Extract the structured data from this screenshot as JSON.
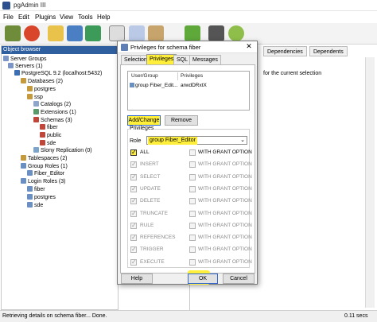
{
  "app": {
    "title": "pgAdmin III"
  },
  "menu": [
    "File",
    "Edit",
    "Plugins",
    "View",
    "Tools",
    "Help"
  ],
  "toolbar_icons": [
    "connect-icon",
    "refresh-icon",
    "folder-icon",
    "properties-icon",
    "recycle-icon",
    "sql-icon",
    "table-icon",
    "pencil-icon",
    "plugin-icon",
    "filter-icon",
    "help-icon"
  ],
  "object_browser": {
    "header": "Object browser",
    "tree": [
      {
        "label": "Server Groups",
        "icon": "server-groups-icon"
      },
      {
        "label": "Servers (1)",
        "icon": "servers-icon"
      },
      {
        "label": "PostgreSQL 9.2 (localhost:5432)",
        "icon": "server-icon"
      },
      {
        "label": "Databases (2)",
        "icon": "databases-icon"
      },
      {
        "label": "postgres",
        "icon": "database-icon"
      },
      {
        "label": "ssp",
        "icon": "database-icon"
      },
      {
        "label": "Catalogs (2)",
        "icon": "catalogs-icon"
      },
      {
        "label": "Extensions (1)",
        "icon": "extensions-icon"
      },
      {
        "label": "Schemas (3)",
        "icon": "schemas-icon"
      },
      {
        "label": "fiber",
        "icon": "schema-icon"
      },
      {
        "label": "public",
        "icon": "schema-icon"
      },
      {
        "label": "sde",
        "icon": "schema-icon"
      },
      {
        "label": "Slony Replication (0)",
        "icon": "slony-icon"
      },
      {
        "label": "Tablespaces (2)",
        "icon": "tablespaces-icon"
      },
      {
        "label": "Group Roles (1)",
        "icon": "group-roles-icon"
      },
      {
        "label": "Fiber_Editor",
        "icon": "group-role-icon"
      },
      {
        "label": "Login Roles (3)",
        "icon": "login-roles-icon"
      },
      {
        "label": "fiber",
        "icon": "login-role-icon"
      },
      {
        "label": "postgres",
        "icon": "login-role-icon"
      },
      {
        "label": "sde",
        "icon": "login-role-icon"
      }
    ]
  },
  "right_pane": {
    "tabs": [
      "Dependencies",
      "Dependents"
    ],
    "text": "for the current selection"
  },
  "dialog": {
    "title": "Privileges for schema fiber",
    "tabs": [
      "Selection",
      "Privileges",
      "SQL",
      "Messages"
    ],
    "active_tab": "Privileges",
    "list_headers": [
      "User/Group",
      "Privileges"
    ],
    "list_rows": [
      {
        "user": "group Fiber_Edit...",
        "privileges": "arwdDRxtX"
      }
    ],
    "add_change_label": "Add/Change",
    "remove_label": "Remove",
    "group_label": "Privileges",
    "role_label": "Role",
    "role_value": "group Fiber_Editor",
    "privileges": [
      {
        "name": "ALL",
        "checked": true
      },
      {
        "name": "INSERT",
        "checked": true
      },
      {
        "name": "SELECT",
        "checked": true
      },
      {
        "name": "UPDATE",
        "checked": true
      },
      {
        "name": "DELETE",
        "checked": true
      },
      {
        "name": "TRUNCATE",
        "checked": true
      },
      {
        "name": "RULE",
        "checked": true
      },
      {
        "name": "REFERENCES",
        "checked": true
      },
      {
        "name": "TRIGGER",
        "checked": true
      },
      {
        "name": "EXECUTE",
        "checked": true
      }
    ],
    "with_grant_option": "WITH GRANT OPTION",
    "help_label": "Help",
    "ok_label": "OK",
    "cancel_label": "Cancel"
  },
  "status": {
    "message": "Retrieving details on schema fiber... Done.",
    "time": "0.11 secs"
  },
  "colors": {
    "highlight": "#ffef3a",
    "header_blue": "#2f5f9e"
  }
}
